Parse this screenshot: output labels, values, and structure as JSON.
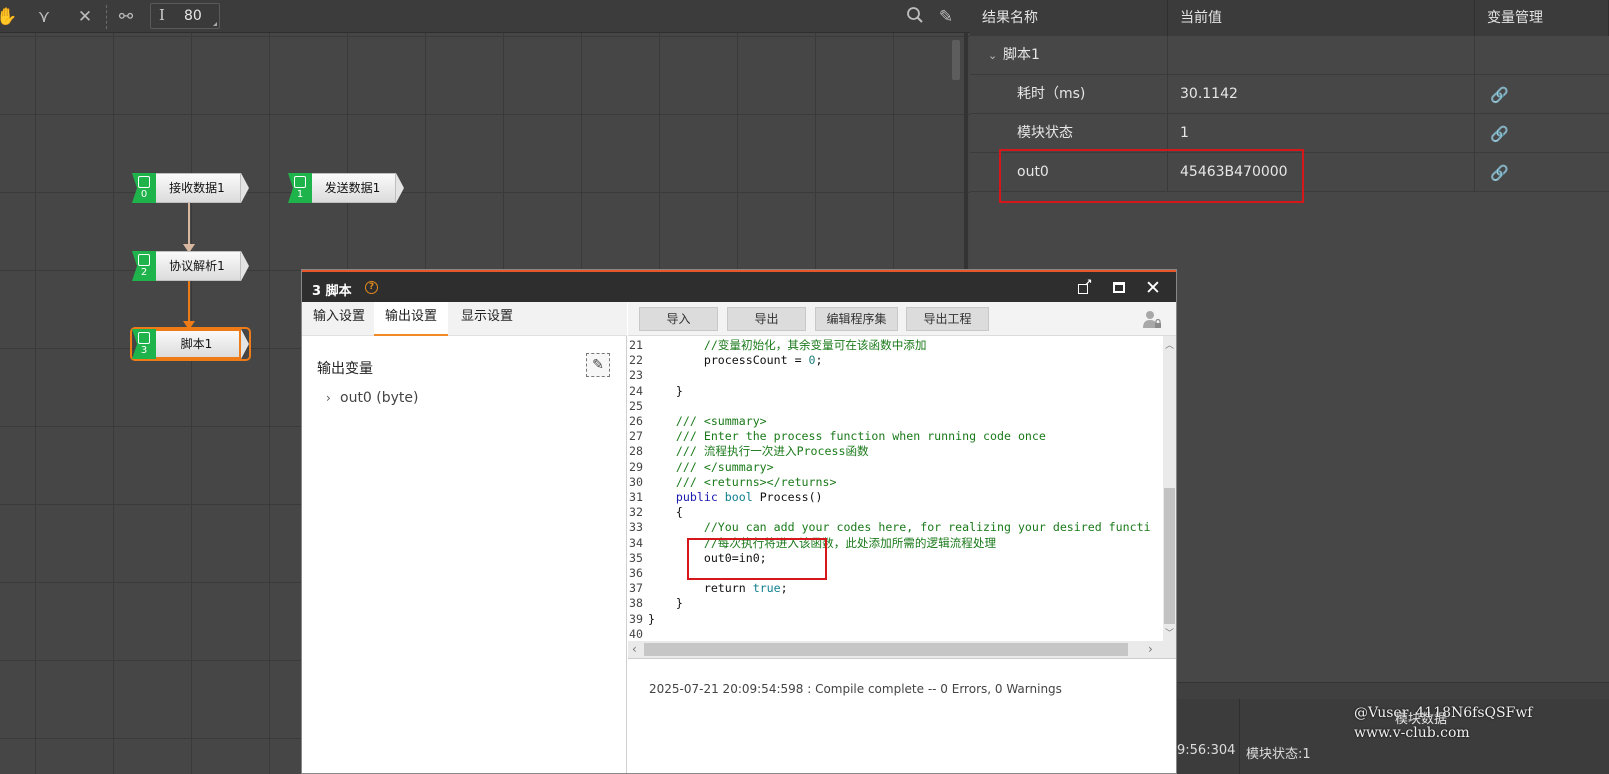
{
  "toolbar": {
    "zoom_value": "80",
    "icons": [
      "hand-icon",
      "merge-icon",
      "cut-icon",
      "link-icon",
      "text-height-icon",
      "search-icon",
      "pencil-icon"
    ]
  },
  "flow": {
    "nodes": [
      {
        "index": "0",
        "label": "接收数据1"
      },
      {
        "index": "1",
        "label": "发送数据1"
      },
      {
        "index": "2",
        "label": "协议解析1"
      },
      {
        "index": "3",
        "label": "脚本1"
      }
    ]
  },
  "results": {
    "headers": {
      "name": "结果名称",
      "value": "当前值",
      "manage": "变量管理"
    },
    "group": "脚本1",
    "rows": [
      {
        "name": "耗时（ms)",
        "value": "30.1142"
      },
      {
        "name": "模块状态",
        "value": "1"
      },
      {
        "name": "out0",
        "value": "45463B470000"
      }
    ]
  },
  "dialog": {
    "title": "3 脚本",
    "help": "?",
    "tabs": [
      "输入设置",
      "输出设置",
      "显示设置"
    ],
    "active_tab": "输出设置",
    "output_title": "输出变量",
    "output_item": "out0 (byte)",
    "code_buttons": [
      "导入",
      "导出",
      "编辑程序集",
      "导出工程"
    ],
    "code_lines": [
      {
        "no": "21",
        "indent": "        ",
        "segs": [
          {
            "c": "cm",
            "t": "//变量初始化，其余变量可在该函数中添加"
          }
        ]
      },
      {
        "no": "22",
        "indent": "        ",
        "segs": [
          {
            "c": "tx",
            "t": "processCount = "
          },
          {
            "c": "nm",
            "t": "0"
          },
          {
            "c": "tx",
            "t": ";"
          }
        ]
      },
      {
        "no": "23",
        "indent": "",
        "segs": []
      },
      {
        "no": "24",
        "indent": "    ",
        "segs": [
          {
            "c": "tx",
            "t": "}"
          }
        ]
      },
      {
        "no": "25",
        "indent": "",
        "segs": []
      },
      {
        "no": "26",
        "indent": "    ",
        "segs": [
          {
            "c": "cm",
            "t": "/// <summary>"
          }
        ]
      },
      {
        "no": "27",
        "indent": "    ",
        "segs": [
          {
            "c": "cm",
            "t": "/// Enter the process function when running code once"
          }
        ]
      },
      {
        "no": "28",
        "indent": "    ",
        "segs": [
          {
            "c": "cm",
            "t": "/// 流程执行一次进入Process函数"
          }
        ]
      },
      {
        "no": "29",
        "indent": "    ",
        "segs": [
          {
            "c": "cm",
            "t": "/// </summary>"
          }
        ]
      },
      {
        "no": "30",
        "indent": "    ",
        "segs": [
          {
            "c": "cm",
            "t": "/// <returns></returns>"
          }
        ]
      },
      {
        "no": "31",
        "indent": "    ",
        "segs": [
          {
            "c": "kw",
            "t": "public "
          },
          {
            "c": "kt",
            "t": "bool "
          },
          {
            "c": "tx",
            "t": "Process()"
          }
        ]
      },
      {
        "no": "32",
        "indent": "    ",
        "segs": [
          {
            "c": "tx",
            "t": "{"
          }
        ]
      },
      {
        "no": "33",
        "indent": "        ",
        "segs": [
          {
            "c": "cm",
            "t": "//You can add your codes here, for realizing your desired functi"
          }
        ]
      },
      {
        "no": "34",
        "indent": "        ",
        "segs": [
          {
            "c": "cm",
            "t": "//每次执行将进入该函数，此处添加所需的逻辑流程处理"
          }
        ]
      },
      {
        "no": "35",
        "indent": "        ",
        "segs": [
          {
            "c": "tx",
            "t": "out0=in0;"
          }
        ]
      },
      {
        "no": "36",
        "indent": "",
        "segs": []
      },
      {
        "no": "37",
        "indent": "        ",
        "segs": [
          {
            "c": "tx",
            "t": "return "
          },
          {
            "c": "kt",
            "t": "true"
          },
          {
            "c": "tx",
            "t": ";"
          }
        ]
      },
      {
        "no": "38",
        "indent": "    ",
        "segs": [
          {
            "c": "tx",
            "t": "}"
          }
        ]
      },
      {
        "no": "39",
        "indent": "",
        "segs": [
          {
            "c": "tx",
            "t": "}"
          }
        ]
      },
      {
        "no": "40",
        "indent": "",
        "segs": []
      }
    ],
    "compile_message": "2025-07-21 20:09:54:598 : Compile complete -- 0 Errors, 0 Warnings"
  },
  "bottom_log": {
    "time_fragment": "9:56:304",
    "text_fragment": "模块状态:1",
    "overlay": "模块数据"
  },
  "watermark": {
    "line1": "@Vuser_4118N6fsQSFwf",
    "line2": "www.v-club.com"
  },
  "colors": {
    "accent_orange": "#ef7b16",
    "node_green": "#1fb34b",
    "highlight_red": "#d7161b",
    "title_bar_accent": "#e8562a"
  }
}
